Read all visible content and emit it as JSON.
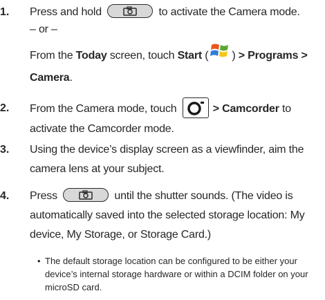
{
  "steps": [
    {
      "number": "1.",
      "text_before_key": "Press and hold",
      "text_after_key": "to activate the Camera mode.",
      "or_line": "– or –",
      "from_prefix": "From the ",
      "today_word": "Today",
      "screen_touch": " screen, touch ",
      "start_word": "Start",
      "paren_open": " (",
      "paren_close": ") ",
      "programs_path": "> Programs >",
      "camera_word": "Camera",
      "period": "."
    },
    {
      "number": "2.",
      "text_before_icon": "From the Camera mode, touch",
      "camcorder_path": "> Camcorder",
      "text_after_icon": " to",
      "line2": "activate the Camcorder mode."
    },
    {
      "number": "3.",
      "line1": "Using the device’s display screen as a viewfinder, aim the",
      "line2": "camera lens at your subject."
    },
    {
      "number": "4.",
      "text_before_key": "Press",
      "text_after_key": "until the shutter sounds. (The video is",
      "line2": "automatically saved into the selected storage location: My",
      "line3": "device, My Storage, or Storage Card.)"
    }
  ],
  "bullet": {
    "symbol": "•",
    "line1": "The default storage location can be configured to be either your",
    "line2": "device’s internal storage hardware or within a DCIM folder on your",
    "line3": "microSD card."
  },
  "icons": {
    "camera_key": "camera-key-icon",
    "windows_start": "windows-start-icon",
    "camera_mode": "camera-mode-icon"
  }
}
